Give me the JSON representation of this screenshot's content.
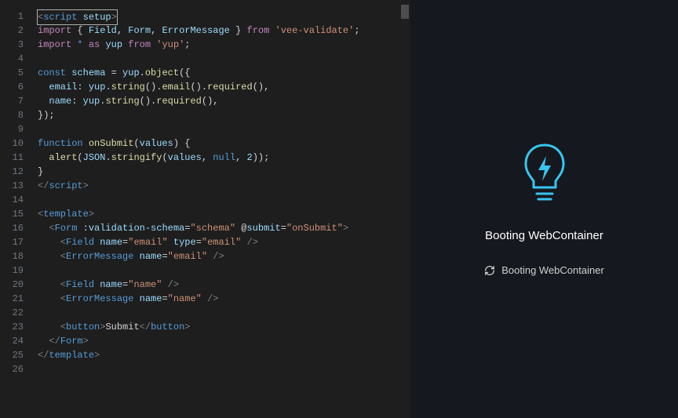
{
  "editor": {
    "lines": [
      [
        [
          "punc",
          "<"
        ],
        [
          "tag",
          "script"
        ],
        [
          "default",
          " "
        ],
        [
          "name",
          "setup"
        ],
        [
          "punc",
          ">"
        ]
      ],
      [
        [
          "keyword",
          "import"
        ],
        [
          "default",
          " { "
        ],
        [
          "name",
          "Field"
        ],
        [
          "default",
          ", "
        ],
        [
          "name",
          "Form"
        ],
        [
          "default",
          ", "
        ],
        [
          "name",
          "ErrorMessage"
        ],
        [
          "default",
          " } "
        ],
        [
          "keyword",
          "from"
        ],
        [
          "default",
          " "
        ],
        [
          "string",
          "'vee-validate'"
        ],
        [
          "default",
          ";"
        ]
      ],
      [
        [
          "keyword",
          "import"
        ],
        [
          "default",
          " "
        ],
        [
          "kwblue",
          "*"
        ],
        [
          "default",
          " "
        ],
        [
          "keyword",
          "as"
        ],
        [
          "default",
          " "
        ],
        [
          "name",
          "yup"
        ],
        [
          "default",
          " "
        ],
        [
          "keyword",
          "from"
        ],
        [
          "default",
          " "
        ],
        [
          "string",
          "'yup'"
        ],
        [
          "default",
          ";"
        ]
      ],
      [],
      [
        [
          "kwblue",
          "const"
        ],
        [
          "default",
          " "
        ],
        [
          "name",
          "schema"
        ],
        [
          "default",
          " = "
        ],
        [
          "name",
          "yup"
        ],
        [
          "default",
          "."
        ],
        [
          "func",
          "object"
        ],
        [
          "default",
          "({"
        ]
      ],
      [
        [
          "default",
          "  "
        ],
        [
          "name",
          "email"
        ],
        [
          "default",
          ": "
        ],
        [
          "name",
          "yup"
        ],
        [
          "default",
          "."
        ],
        [
          "func",
          "string"
        ],
        [
          "default",
          "()."
        ],
        [
          "func",
          "email"
        ],
        [
          "default",
          "()."
        ],
        [
          "func",
          "required"
        ],
        [
          "default",
          "(),"
        ]
      ],
      [
        [
          "default",
          "  "
        ],
        [
          "name",
          "name"
        ],
        [
          "default",
          ": "
        ],
        [
          "name",
          "yup"
        ],
        [
          "default",
          "."
        ],
        [
          "func",
          "string"
        ],
        [
          "default",
          "()."
        ],
        [
          "func",
          "required"
        ],
        [
          "default",
          "(),"
        ]
      ],
      [
        [
          "default",
          "});"
        ]
      ],
      [],
      [
        [
          "kwblue",
          "function"
        ],
        [
          "default",
          " "
        ],
        [
          "func",
          "onSubmit"
        ],
        [
          "default",
          "("
        ],
        [
          "name",
          "values"
        ],
        [
          "default",
          ") {"
        ]
      ],
      [
        [
          "default",
          "  "
        ],
        [
          "func",
          "alert"
        ],
        [
          "default",
          "("
        ],
        [
          "name",
          "JSON"
        ],
        [
          "default",
          "."
        ],
        [
          "func",
          "stringify"
        ],
        [
          "default",
          "("
        ],
        [
          "name",
          "values"
        ],
        [
          "default",
          ", "
        ],
        [
          "kwblue",
          "null"
        ],
        [
          "default",
          ", "
        ],
        [
          "name",
          "2"
        ],
        [
          "default",
          "));"
        ]
      ],
      [
        [
          "default",
          "}"
        ]
      ],
      [
        [
          "punc",
          "</"
        ],
        [
          "tag",
          "script"
        ],
        [
          "punc",
          ">"
        ]
      ],
      [],
      [
        [
          "punc",
          "<"
        ],
        [
          "tag",
          "template"
        ],
        [
          "punc",
          ">"
        ]
      ],
      [
        [
          "default",
          "  "
        ],
        [
          "punc",
          "<"
        ],
        [
          "tag",
          "Form"
        ],
        [
          "default",
          " :"
        ],
        [
          "name",
          "validation-schema"
        ],
        [
          "default",
          "="
        ],
        [
          "string",
          "\"schema\""
        ],
        [
          "default",
          " @"
        ],
        [
          "name",
          "submit"
        ],
        [
          "default",
          "="
        ],
        [
          "string",
          "\"onSubmit\""
        ],
        [
          "punc",
          ">"
        ]
      ],
      [
        [
          "default",
          "    "
        ],
        [
          "punc",
          "<"
        ],
        [
          "tag",
          "Field"
        ],
        [
          "default",
          " "
        ],
        [
          "name",
          "name"
        ],
        [
          "default",
          "="
        ],
        [
          "string",
          "\"email\""
        ],
        [
          "default",
          " "
        ],
        [
          "name",
          "type"
        ],
        [
          "default",
          "="
        ],
        [
          "string",
          "\"email\""
        ],
        [
          "default",
          " "
        ],
        [
          "punc",
          "/>"
        ]
      ],
      [
        [
          "default",
          "    "
        ],
        [
          "punc",
          "<"
        ],
        [
          "tag",
          "ErrorMessage"
        ],
        [
          "default",
          " "
        ],
        [
          "name",
          "name"
        ],
        [
          "default",
          "="
        ],
        [
          "string",
          "\"email\""
        ],
        [
          "default",
          " "
        ],
        [
          "punc",
          "/>"
        ]
      ],
      [],
      [
        [
          "default",
          "    "
        ],
        [
          "punc",
          "<"
        ],
        [
          "tag",
          "Field"
        ],
        [
          "default",
          " "
        ],
        [
          "name",
          "name"
        ],
        [
          "default",
          "="
        ],
        [
          "string",
          "\"name\""
        ],
        [
          "default",
          " "
        ],
        [
          "punc",
          "/>"
        ]
      ],
      [
        [
          "default",
          "    "
        ],
        [
          "punc",
          "<"
        ],
        [
          "tag",
          "ErrorMessage"
        ],
        [
          "default",
          " "
        ],
        [
          "name",
          "name"
        ],
        [
          "default",
          "="
        ],
        [
          "string",
          "\"name\""
        ],
        [
          "default",
          " "
        ],
        [
          "punc",
          "/>"
        ]
      ],
      [],
      [
        [
          "default",
          "    "
        ],
        [
          "punc",
          "<"
        ],
        [
          "tag",
          "button"
        ],
        [
          "punc",
          ">"
        ],
        [
          "default",
          "Submit"
        ],
        [
          "punc",
          "</"
        ],
        [
          "tag",
          "button"
        ],
        [
          "punc",
          ">"
        ]
      ],
      [
        [
          "default",
          "  "
        ],
        [
          "punc",
          "</"
        ],
        [
          "tag",
          "Form"
        ],
        [
          "punc",
          ">"
        ]
      ],
      [
        [
          "punc",
          "</"
        ],
        [
          "tag",
          "template"
        ],
        [
          "punc",
          ">"
        ]
      ],
      []
    ],
    "line_count": 26,
    "cursor_line": 1
  },
  "preview": {
    "status_main": "Booting WebContainer",
    "status_sub": "Booting WebContainer",
    "icon": "lightning-bulb-icon",
    "spinner_icon": "refresh-icon",
    "accent_color": "#36c5f0"
  }
}
